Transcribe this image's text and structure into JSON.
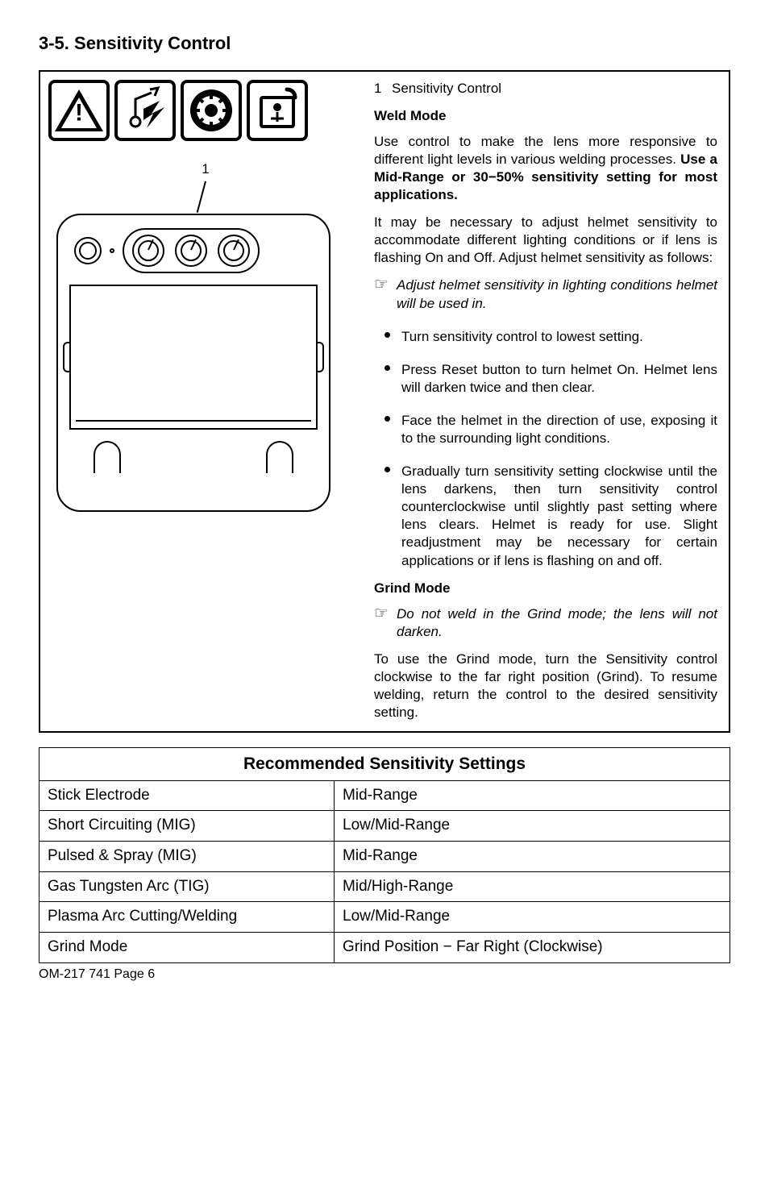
{
  "section_title": "3-5.  Sensitivity Control",
  "callout_num": "1",
  "right": {
    "item_num": "1",
    "item_label": "Sensitivity Control",
    "weld_mode_head": "Weld Mode",
    "p1a": "Use control to make the lens more responsive to different light levels  in various welding processes.  ",
    "p1b": "Use a Mid-Range or 30−50% sensitivity setting for most applications.",
    "p2": "It may be necessary to adjust helmet sensitivity to accommodate different lighting conditions or if lens is flashing On and Off. Adjust  helmet sensitivity as follows:",
    "note1": "Adjust helmet sensitivity in lighting conditions helmet will be used in.",
    "b1": "Turn sensitivity control to lowest setting.",
    "b2": "Press  Reset button  to turn helmet On. Helmet lens will darken twice and then clear.",
    "b3": "Face the helmet in the direction of use, exposing it to the surrounding light conditions.",
    "b4": "Gradually turn sensitivity setting clockwise until the lens darkens, then turn sensitivity control counterclockwise until slightly past setting where lens clears. Helmet is ready for use. Slight readjustment may be necessary for certain applications or if lens is flashing on and off.",
    "grind_head": "Grind Mode",
    "note2": "Do not weld in the Grind mode; the lens will not darken.",
    "p3": "To use the Grind mode, turn the Sensitivity control clockwise to the far right position (Grind). To resume welding, return the control to the desired sensitivity setting."
  },
  "table": {
    "title": "Recommended Sensitivity Settings",
    "rows": [
      {
        "l": "Stick Electrode",
        "r": "Mid-Range"
      },
      {
        "l": "Short Circuiting (MIG)",
        "r": "Low/Mid-Range"
      },
      {
        "l": "Pulsed & Spray (MIG)",
        "r": "Mid-Range"
      },
      {
        "l": "Gas Tungsten Arc (TIG)",
        "r": "Mid/High-Range"
      },
      {
        "l": "Plasma Arc Cutting/Welding",
        "r": "Low/Mid-Range"
      },
      {
        "l": "Grind Mode",
        "r": "Grind Position − Far Right (Clockwise)"
      }
    ]
  },
  "footer": "OM-217 741 Page 6"
}
